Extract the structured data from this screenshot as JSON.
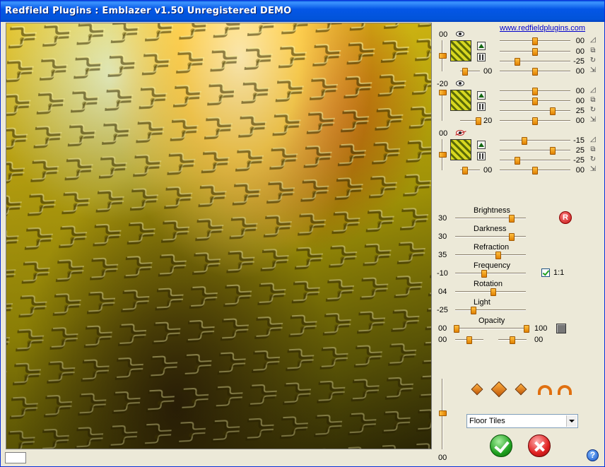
{
  "window": {
    "title": "Redfield Plugins : Emblazer v1.50   Unregistered  DEMO"
  },
  "link": "www.redfieldplugins.com",
  "layers": [
    {
      "depth": "00",
      "bottom_value": "00",
      "values": [
        "00",
        "00",
        "-25",
        "00"
      ]
    },
    {
      "depth": "-20",
      "bottom_value": "20",
      "values": [
        "00",
        "00",
        "25",
        "00"
      ]
    },
    {
      "depth": "00",
      "bottom_value": "00",
      "values": [
        "-15",
        "25",
        "-25",
        "00"
      ]
    }
  ],
  "params": [
    {
      "label": "Brightness",
      "value": "30"
    },
    {
      "label": "Darkness",
      "value": "30"
    },
    {
      "label": "Refraction",
      "value": "35"
    },
    {
      "label": "Frequency",
      "value": "-10"
    },
    {
      "label": "Rotation",
      "value": "04"
    },
    {
      "label": "Light",
      "value": "-25"
    }
  ],
  "opacity": {
    "label": "Opacity",
    "min": "00",
    "max": "100",
    "low_left": "00",
    "low_right": "00"
  },
  "checkbox": {
    "label": "1:1",
    "checked": true
  },
  "reset": {
    "label": "R"
  },
  "zoom": {
    "value": "00"
  },
  "preset": {
    "selected": "Floor Tiles"
  },
  "help": {
    "label": "?"
  },
  "colors": {
    "title_bar": "#0456e6",
    "accent": "#e08000",
    "ok": "#20a020",
    "cancel": "#e02020"
  }
}
